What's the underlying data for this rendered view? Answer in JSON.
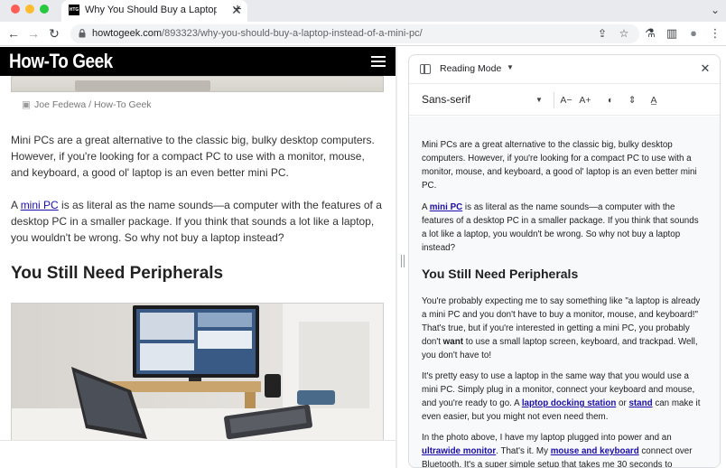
{
  "browser": {
    "tab_title": "Why You Should Buy a Laptop",
    "tab_favicon_text": "HTG",
    "tab_close": "✕",
    "new_tab": "+",
    "tab_search": "⌄",
    "url_host": "howtogeek.com",
    "url_path": "/893323/why-you-should-buy-a-laptop-instead-of-a-mini-pc/",
    "icons": {
      "back": "←",
      "forward": "→",
      "reload": "↻",
      "share": "⇪",
      "bookmark": "☆",
      "labs": "⚗",
      "side_panel": "▥",
      "profile": "●",
      "menu": "⋮"
    }
  },
  "page": {
    "logo": "How-To Geek",
    "caption": "Joe Fedewa / How-To Geek",
    "camera_icon": "▣",
    "p1": "Mini PCs are a great alternative to the classic big, bulky desktop computers. However, if you're looking for a compact PC to use with a monitor, mouse, and keyboard, a good ol' laptop is an even better mini PC.",
    "p2_before": "A ",
    "p2_link": "mini PC",
    "p2_after": " is as literal as the name sounds—a computer with the features of a desktop PC in a smaller package. If you think that sounds a lot like a laptop, you wouldn't be wrong. So why not buy a laptop instead?",
    "heading": "You Still Need Peripherals"
  },
  "reading_mode": {
    "title": "Reading Mode",
    "caret": "▼",
    "close": "✕",
    "font": "Sans-serif",
    "tools": {
      "decrease_font": "A−",
      "increase_font": "A+",
      "theme": "◐",
      "line_spacing": "⇕",
      "letter_spacing": "A̲"
    },
    "p1": "Mini PCs are a great alternative to the classic big, bulky desktop computers. However, if you're looking for a compact PC to use with a monitor, mouse, and keyboard, a good ol' laptop is an even better mini PC.",
    "p2_before": "A ",
    "p2_link": "mini PC",
    "p2_after": " is as literal as the name sounds—a computer with the features of a desktop PC in a smaller package. If you think that sounds a lot like a laptop, you wouldn't be wrong. So why not buy a laptop instead?",
    "heading": "You Still Need Peripherals",
    "p3_before": "You're probably expecting me to say something like \"a laptop is already a mini PC and you don't have to buy a monitor, mouse, and keyboard!\" That's true, but if you're interested in getting a mini PC, you probably don't ",
    "p3_bold": "want",
    "p3_after": " to use a small laptop screen, keyboard, and trackpad. Well, you don't have to!",
    "p4_before": "It's pretty easy to use a laptop in the same way that you would use a mini PC. Simply plug in a monitor, connect your keyboard and mouse, and you're ready to go. A ",
    "p4_link1": "laptop docking station",
    "p4_mid": " or ",
    "p4_link2": "stand",
    "p4_after": " can make it even easier, but you might not even need them.",
    "p5_before": "In the photo above, I have my laptop plugged into power and an ",
    "p5_link1": "ultrawide monitor",
    "p5_mid": ". That's it. My ",
    "p5_link2": "mouse and keyboard",
    "p5_after": " connect over Bluetooth. It's a super simple setup that takes me 30 seconds to"
  }
}
